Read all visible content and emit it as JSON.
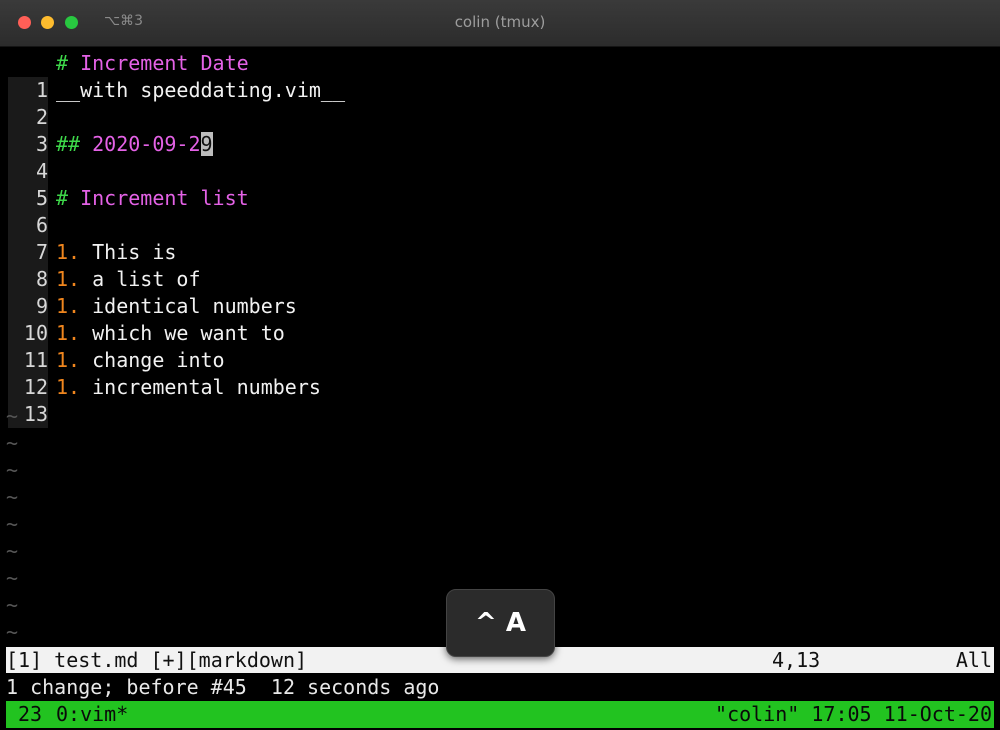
{
  "window": {
    "shortcut": "⌥⌘3",
    "title": "colin (tmux)"
  },
  "editor": {
    "lines": [
      {
        "num": "1",
        "hash": "#",
        "text": " Increment Date"
      },
      {
        "num": "2",
        "text": "__with speeddating.vim__"
      },
      {
        "num": "3"
      },
      {
        "num": "4",
        "hash": "##",
        "date_before_cursor": " 2020-09-2",
        "cursor_char": "9"
      },
      {
        "num": "5"
      },
      {
        "num": "6",
        "hash": "#",
        "text": " Increment list"
      },
      {
        "num": "7"
      },
      {
        "num": "8",
        "marker": "1.",
        "text": " This is"
      },
      {
        "num": "9",
        "marker": "1.",
        "text": " a list of"
      },
      {
        "num": "10",
        "marker": "1.",
        "text": " identical numbers"
      },
      {
        "num": "11",
        "marker": "1.",
        "text": " which we want to"
      },
      {
        "num": "12",
        "marker": "1.",
        "text": " change into"
      },
      {
        "num": "13",
        "marker": "1.",
        "text": " incremental numbers"
      }
    ],
    "tilde": "~"
  },
  "statusline": {
    "left": "[1] test.md [+][markdown]",
    "position": "4,13",
    "scroll": "All"
  },
  "message": "1 change; before #45  12 seconds ago",
  "tmux": {
    "window_number": "23",
    "tab": "0:vim*",
    "right": "\"colin\" 17:05 11-Oct-20"
  },
  "keycast": "^ A",
  "colors": {
    "heading": "#e462e6",
    "hash": "#3ed84a",
    "list_marker": "#f0861e",
    "tmux_bar": "#22c320"
  }
}
